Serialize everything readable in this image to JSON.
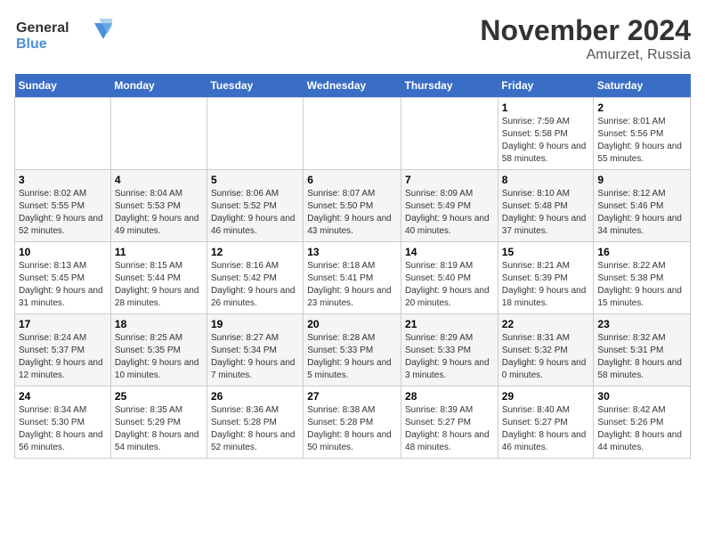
{
  "header": {
    "logo_line1": "General",
    "logo_line2": "Blue",
    "month": "November 2024",
    "location": "Amurzet, Russia"
  },
  "days_of_week": [
    "Sunday",
    "Monday",
    "Tuesday",
    "Wednesday",
    "Thursday",
    "Friday",
    "Saturday"
  ],
  "weeks": [
    [
      {
        "day": "",
        "info": ""
      },
      {
        "day": "",
        "info": ""
      },
      {
        "day": "",
        "info": ""
      },
      {
        "day": "",
        "info": ""
      },
      {
        "day": "",
        "info": ""
      },
      {
        "day": "1",
        "info": "Sunrise: 7:59 AM\nSunset: 5:58 PM\nDaylight: 9 hours and 58 minutes."
      },
      {
        "day": "2",
        "info": "Sunrise: 8:01 AM\nSunset: 5:56 PM\nDaylight: 9 hours and 55 minutes."
      }
    ],
    [
      {
        "day": "3",
        "info": "Sunrise: 8:02 AM\nSunset: 5:55 PM\nDaylight: 9 hours and 52 minutes."
      },
      {
        "day": "4",
        "info": "Sunrise: 8:04 AM\nSunset: 5:53 PM\nDaylight: 9 hours and 49 minutes."
      },
      {
        "day": "5",
        "info": "Sunrise: 8:06 AM\nSunset: 5:52 PM\nDaylight: 9 hours and 46 minutes."
      },
      {
        "day": "6",
        "info": "Sunrise: 8:07 AM\nSunset: 5:50 PM\nDaylight: 9 hours and 43 minutes."
      },
      {
        "day": "7",
        "info": "Sunrise: 8:09 AM\nSunset: 5:49 PM\nDaylight: 9 hours and 40 minutes."
      },
      {
        "day": "8",
        "info": "Sunrise: 8:10 AM\nSunset: 5:48 PM\nDaylight: 9 hours and 37 minutes."
      },
      {
        "day": "9",
        "info": "Sunrise: 8:12 AM\nSunset: 5:46 PM\nDaylight: 9 hours and 34 minutes."
      }
    ],
    [
      {
        "day": "10",
        "info": "Sunrise: 8:13 AM\nSunset: 5:45 PM\nDaylight: 9 hours and 31 minutes."
      },
      {
        "day": "11",
        "info": "Sunrise: 8:15 AM\nSunset: 5:44 PM\nDaylight: 9 hours and 28 minutes."
      },
      {
        "day": "12",
        "info": "Sunrise: 8:16 AM\nSunset: 5:42 PM\nDaylight: 9 hours and 26 minutes."
      },
      {
        "day": "13",
        "info": "Sunrise: 8:18 AM\nSunset: 5:41 PM\nDaylight: 9 hours and 23 minutes."
      },
      {
        "day": "14",
        "info": "Sunrise: 8:19 AM\nSunset: 5:40 PM\nDaylight: 9 hours and 20 minutes."
      },
      {
        "day": "15",
        "info": "Sunrise: 8:21 AM\nSunset: 5:39 PM\nDaylight: 9 hours and 18 minutes."
      },
      {
        "day": "16",
        "info": "Sunrise: 8:22 AM\nSunset: 5:38 PM\nDaylight: 9 hours and 15 minutes."
      }
    ],
    [
      {
        "day": "17",
        "info": "Sunrise: 8:24 AM\nSunset: 5:37 PM\nDaylight: 9 hours and 12 minutes."
      },
      {
        "day": "18",
        "info": "Sunrise: 8:25 AM\nSunset: 5:35 PM\nDaylight: 9 hours and 10 minutes."
      },
      {
        "day": "19",
        "info": "Sunrise: 8:27 AM\nSunset: 5:34 PM\nDaylight: 9 hours and 7 minutes."
      },
      {
        "day": "20",
        "info": "Sunrise: 8:28 AM\nSunset: 5:33 PM\nDaylight: 9 hours and 5 minutes."
      },
      {
        "day": "21",
        "info": "Sunrise: 8:29 AM\nSunset: 5:33 PM\nDaylight: 9 hours and 3 minutes."
      },
      {
        "day": "22",
        "info": "Sunrise: 8:31 AM\nSunset: 5:32 PM\nDaylight: 9 hours and 0 minutes."
      },
      {
        "day": "23",
        "info": "Sunrise: 8:32 AM\nSunset: 5:31 PM\nDaylight: 8 hours and 58 minutes."
      }
    ],
    [
      {
        "day": "24",
        "info": "Sunrise: 8:34 AM\nSunset: 5:30 PM\nDaylight: 8 hours and 56 minutes."
      },
      {
        "day": "25",
        "info": "Sunrise: 8:35 AM\nSunset: 5:29 PM\nDaylight: 8 hours and 54 minutes."
      },
      {
        "day": "26",
        "info": "Sunrise: 8:36 AM\nSunset: 5:28 PM\nDaylight: 8 hours and 52 minutes."
      },
      {
        "day": "27",
        "info": "Sunrise: 8:38 AM\nSunset: 5:28 PM\nDaylight: 8 hours and 50 minutes."
      },
      {
        "day": "28",
        "info": "Sunrise: 8:39 AM\nSunset: 5:27 PM\nDaylight: 8 hours and 48 minutes."
      },
      {
        "day": "29",
        "info": "Sunrise: 8:40 AM\nSunset: 5:27 PM\nDaylight: 8 hours and 46 minutes."
      },
      {
        "day": "30",
        "info": "Sunrise: 8:42 AM\nSunset: 5:26 PM\nDaylight: 8 hours and 44 minutes."
      }
    ]
  ]
}
